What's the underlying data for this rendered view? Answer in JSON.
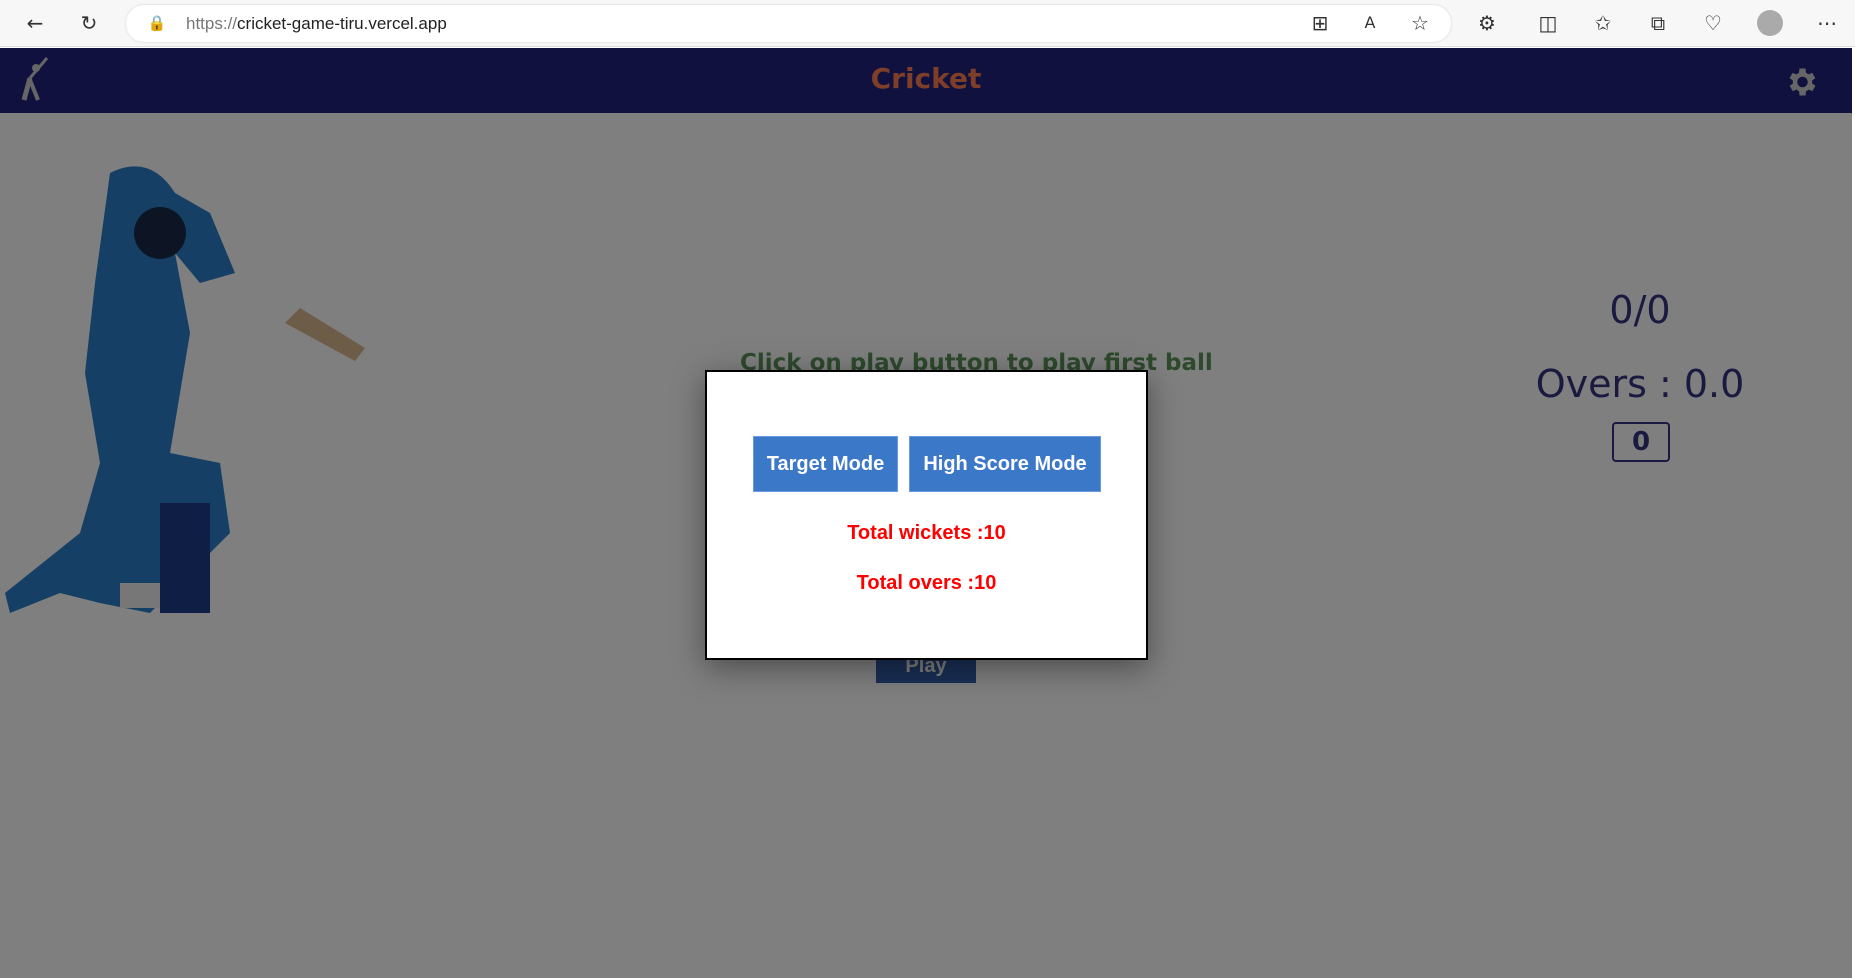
{
  "browser": {
    "url_scheme": "https://",
    "url_host": "cricket-game-tiru.vercel.app"
  },
  "nav": {
    "title": "Cricket"
  },
  "main": {
    "message": "Click on play button to play first ball",
    "play_label": "Play",
    "score": "0/0",
    "overs": "Overs : 0.0",
    "current_ball": "0"
  },
  "modal": {
    "target_mode_label": "Target Mode",
    "high_score_mode_label": "High Score Mode",
    "total_wickets": "Total wickets :10",
    "total_overs": "Total overs :10"
  },
  "colors": {
    "nav_bg": "#222280",
    "title": "#ff7d50",
    "mode_button": "#3c78c8",
    "settings_text": "#ff0000"
  }
}
